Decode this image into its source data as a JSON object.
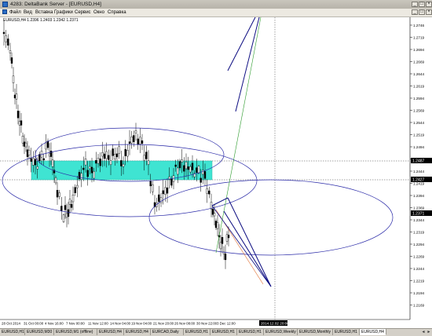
{
  "window": {
    "title": "4283: DeltaBank Server - [EURUSD,H4]"
  },
  "menu": {
    "items": [
      "Файл",
      "Вид",
      "Вставка",
      "Графики",
      "Сервис",
      "Окно",
      "Справка"
    ]
  },
  "chart": {
    "symbol_label": "EURUSD,H4  1.2396 1.2403 1.2342 1.2371",
    "current_price_label": "1.2371",
    "crosshair_price_label": "1.2487",
    "crosshair_price_label2": "1.2427",
    "crosshair_time_label": "2014.12.02 20:00",
    "colors": {
      "candle": "#000000",
      "rectangle": "#3fe4d2",
      "ellipse": "#1c1ca8",
      "line_blue": "#0a0a80",
      "line_green": "#2a9a2a",
      "line_orange": "#e06a2a"
    },
    "price_axis": [
      "1.2746",
      "1.2719",
      "1.2694",
      "1.2669",
      "1.2644",
      "1.2619",
      "1.2594",
      "1.2569",
      "1.2544",
      "1.2519",
      "1.2494",
      "1.2469",
      "1.2444",
      "1.2419",
      "1.2394",
      "1.2369",
      "1.2344",
      "1.2319",
      "1.2294",
      "1.2269",
      "1.2244",
      "1.2219",
      "1.2194",
      "1.2169"
    ],
    "time_axis": [
      "28 Oct 2014",
      "31 Oct 00:00",
      "4 Nov 16:00",
      "7 Nov 00:00",
      "11 Nov 12:00",
      "14 Nov 04:00",
      "19 Nov 04:00",
      "21 Nov 20:00",
      "26 Nov 08:00",
      "30 Nov 22:00",
      "3 Dec 12:00"
    ]
  },
  "tabs": [
    "EURUSD,H1",
    "EURUSD,M30",
    "EURUSD,M1 (offline)",
    "EURUSD,H4",
    "EURUSD,H4",
    "EURCAD,Daily",
    "EURUSD,H1",
    "EURUSD,H1",
    "EURUSD,H1",
    "EURUSD,Weekly",
    "EURUSD,Monthly",
    "EURUSD,H1",
    "EURUSD,H4"
  ]
}
